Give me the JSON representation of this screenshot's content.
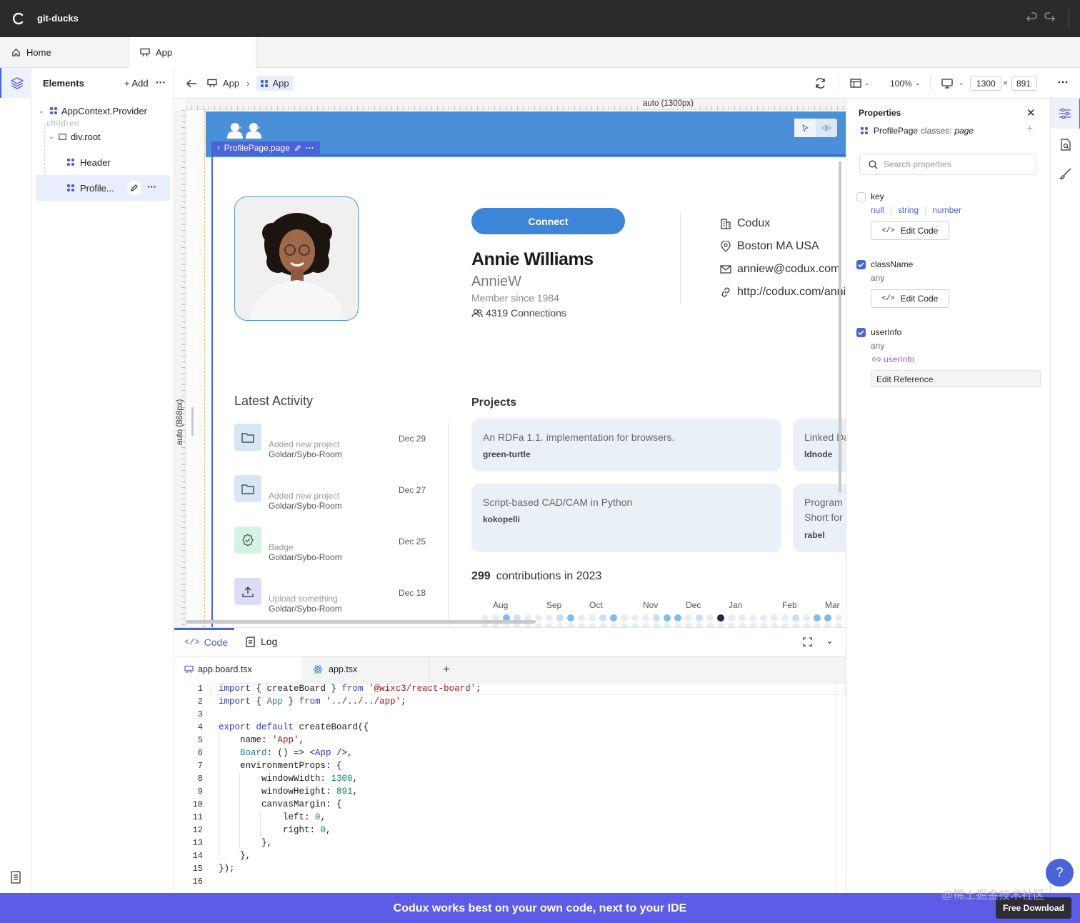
{
  "window": {
    "title": "git-ducks"
  },
  "tabs": [
    {
      "label": "Home",
      "icon": "home-icon"
    },
    {
      "label": "App",
      "icon": "board-icon"
    }
  ],
  "elements_panel": {
    "title": "Elements",
    "add_label": "+ Add",
    "tree": [
      {
        "label": "AppContext.Provider"
      },
      {
        "label": "children"
      },
      {
        "label": "div.root"
      },
      {
        "label": "Header"
      },
      {
        "label": "Profile..."
      }
    ]
  },
  "toolbar": {
    "breadcrumb": [
      "App",
      "App"
    ],
    "zoom": "100%",
    "width": "1300",
    "times": "×",
    "height": "891"
  },
  "stage": {
    "ruler_top": "auto (1300px)",
    "ruler_left": "auto (868px)",
    "selection_label": "ProfilePage.page"
  },
  "profile": {
    "connect_label": "Connect",
    "name": "Annie Williams",
    "username": "AnnieW",
    "member_since": "Member since 1984",
    "connections": "4319 Connections",
    "contacts": [
      {
        "icon": "building-icon",
        "text": "Codux"
      },
      {
        "icon": "location-pin-icon",
        "text": "Boston MA USA"
      },
      {
        "icon": "mail-icon",
        "text": "anniew@codux.com"
      },
      {
        "icon": "link-icon",
        "text": "http://codux.com/annie"
      }
    ]
  },
  "activity": {
    "title": "Latest Activity",
    "items": [
      {
        "icon": "folder-icon",
        "line1": "Added new project",
        "line2": "Goldar/Sybo-Room",
        "date": "Dec 29",
        "bg": "#d6e6f5"
      },
      {
        "icon": "folder-icon",
        "line1": "Added new project",
        "line2": "Goldar/Sybo-Room",
        "date": "Dec 27",
        "bg": "#d6e6f5"
      },
      {
        "icon": "badge-icon",
        "line1": "Badge",
        "line2": "Goldar/Sybo-Room",
        "date": "Dec 25",
        "bg": "#d3f3e3"
      },
      {
        "icon": "upload-icon",
        "line1": "Upload something",
        "line2": "Goldar/Sybo-Room",
        "date": "Dec 18",
        "bg": "#dcdcf7"
      }
    ]
  },
  "projects": {
    "title": "Projects",
    "items": [
      {
        "desc": "An RDFa 1.1. implementation for browsers.",
        "name": "green-turtle"
      },
      {
        "desc": "Linked Data",
        "name": "ldnode"
      },
      {
        "desc": "Script-based CAD/CAM in Python",
        "name": "kokopelli"
      },
      {
        "desc": "Program",
        "desc2": "Short for",
        "name": "rabel"
      }
    ]
  },
  "contributions": {
    "count": "299",
    "label": "contributions in 2023",
    "months": [
      "Aug",
      "Sep",
      "Oct",
      "Nov",
      "Dec",
      "Jan",
      "Feb",
      "Mar"
    ],
    "levels": [
      0,
      0,
      2,
      1,
      0,
      0,
      0,
      1,
      2,
      0,
      0,
      1,
      2,
      0,
      0,
      0,
      1,
      2,
      2,
      0,
      1,
      0,
      3,
      0,
      0,
      0,
      0,
      0,
      0,
      1,
      0,
      2,
      2,
      0,
      1,
      2,
      0,
      0,
      0,
      1,
      0,
      0,
      1,
      0,
      0,
      0,
      1
    ]
  },
  "properties": {
    "title": "Properties",
    "component": "ProfilePage",
    "classes_label": "classes:",
    "classes_value": "page",
    "search_placeholder": "Search properties",
    "key": {
      "name": "key",
      "types": [
        "null",
        "string",
        "number"
      ],
      "button": "Edit Code",
      "checked": false
    },
    "className": {
      "name": "className",
      "type": "any",
      "button": "Edit Code",
      "checked": true
    },
    "userInfo": {
      "name": "userInfo",
      "type": "any",
      "reference": "userInfo",
      "button": "Edit Reference",
      "checked": true
    }
  },
  "code_panel": {
    "tabs": [
      {
        "label": "Code"
      },
      {
        "label": "Log"
      }
    ],
    "files": [
      {
        "label": "app.board.tsx"
      },
      {
        "label": "app.tsx"
      }
    ],
    "line_numbers": [
      "1",
      "2",
      "3",
      "4",
      "5",
      "6",
      "7",
      "8",
      "9",
      "10",
      "11",
      "12",
      "13",
      "14",
      "15",
      "16"
    ]
  },
  "banner": {
    "text": "Codux works best on your own code, next to your IDE",
    "button": "Free Download",
    "help": "?",
    "watermark": "@稀土掘金技术社区"
  },
  "colors": {
    "accent": "#3d85d6",
    "banner": "#5c5ce6",
    "header_blue": "#4a90d9",
    "contribution_levels": [
      "#e8edf3",
      "#c9dff5",
      "#7fbbee",
      "#1c2b3a"
    ]
  }
}
